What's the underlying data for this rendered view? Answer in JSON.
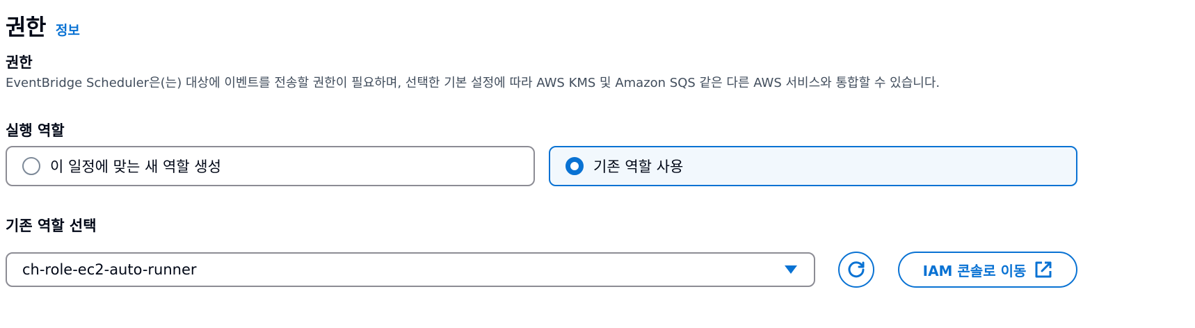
{
  "header": {
    "title": "권한",
    "info_link": "정보"
  },
  "permissions": {
    "label": "권한",
    "description": "EventBridge Scheduler은(는) 대상에 이벤트를 전송할 권한이 필요하며, 선택한 기본 설정에 따라 AWS KMS 및 Amazon SQS 같은 다른 AWS 서비스와 통합할 수 있습니다."
  },
  "execution_role": {
    "label": "실행 역할",
    "options": [
      {
        "label": "이 일정에 맞는 새 역할 생성",
        "selected": false
      },
      {
        "label": "기존 역할 사용",
        "selected": true
      }
    ]
  },
  "existing_role": {
    "label": "기존 역할 선택",
    "selected_value": "ch-role-ec2-auto-runner",
    "iam_button_label": "IAM 콘솔로 이동"
  },
  "icons": {
    "refresh": "refresh-icon",
    "external_link": "external-link-icon",
    "dropdown": "caret-down-icon"
  },
  "colors": {
    "accent": "#0972d3",
    "text": "#000716",
    "secondary_text": "#414d5c",
    "border": "#8c8c94",
    "selected_bg": "#f2f8fd"
  }
}
